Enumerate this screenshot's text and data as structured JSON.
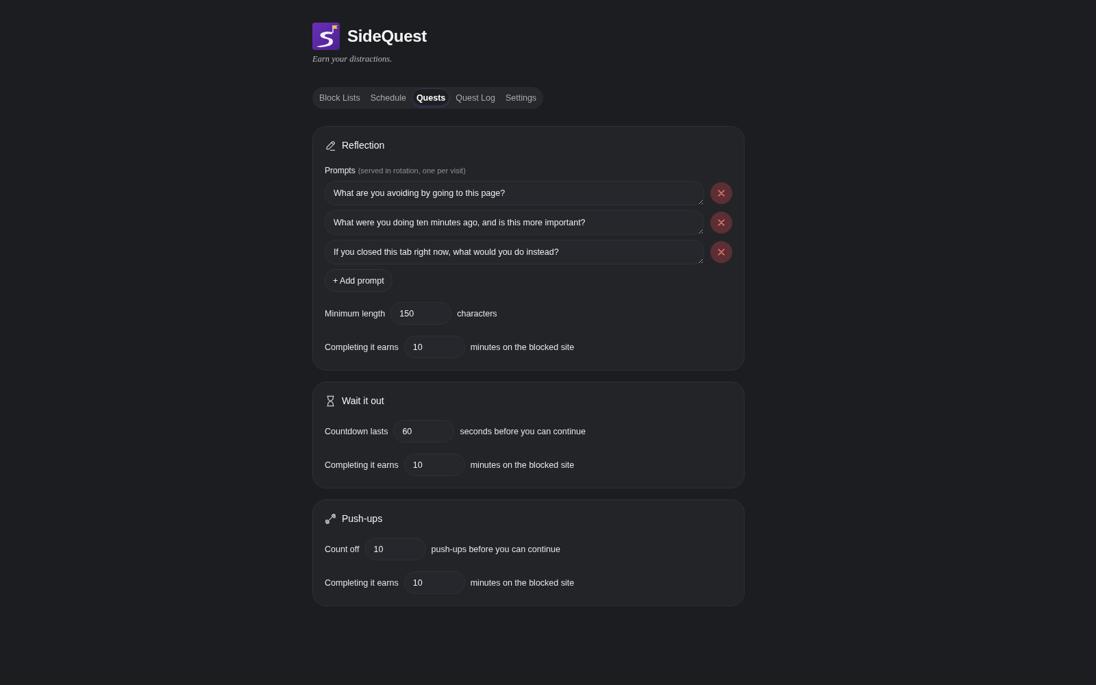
{
  "app": {
    "name": "SideQuest",
    "tagline": "Earn your distractions."
  },
  "tabs": [
    {
      "label": "Block Lists",
      "selected": false
    },
    {
      "label": "Schedule",
      "selected": false
    },
    {
      "label": "Quests",
      "selected": true
    },
    {
      "label": "Quest Log",
      "selected": false
    },
    {
      "label": "Settings",
      "selected": false
    }
  ],
  "quests": [
    {
      "kind": "reflection",
      "title": "Reflection",
      "prompts_label": "Prompts",
      "prompts_hint": "(served in rotation, one per visit)",
      "prompts": [
        "What are you avoiding by going to this page?",
        "What were you doing ten minutes ago, and is this more important?",
        "If you closed this tab right now, what would you do instead?"
      ],
      "add_button": "+ Add prompt",
      "settings": [
        {
          "label": "Minimum length",
          "value": "150",
          "unit": "characters"
        },
        {
          "label": "Completing it earns",
          "value": "10",
          "unit": "minutes on the blocked site"
        }
      ]
    },
    {
      "kind": "wait",
      "title": "Wait it out",
      "settings": [
        {
          "label": "Countdown lasts",
          "value": "60",
          "unit": "seconds before you can continue"
        },
        {
          "label": "Completing it earns",
          "value": "10",
          "unit": "minutes on the blocked site"
        }
      ]
    },
    {
      "kind": "pushups",
      "title": "Push-ups",
      "settings": [
        {
          "label": "Count off",
          "value": "10",
          "unit": "push-ups before you can continue"
        },
        {
          "label": "Completing it earns",
          "value": "10",
          "unit": "minutes on the blocked site"
        }
      ]
    }
  ]
}
